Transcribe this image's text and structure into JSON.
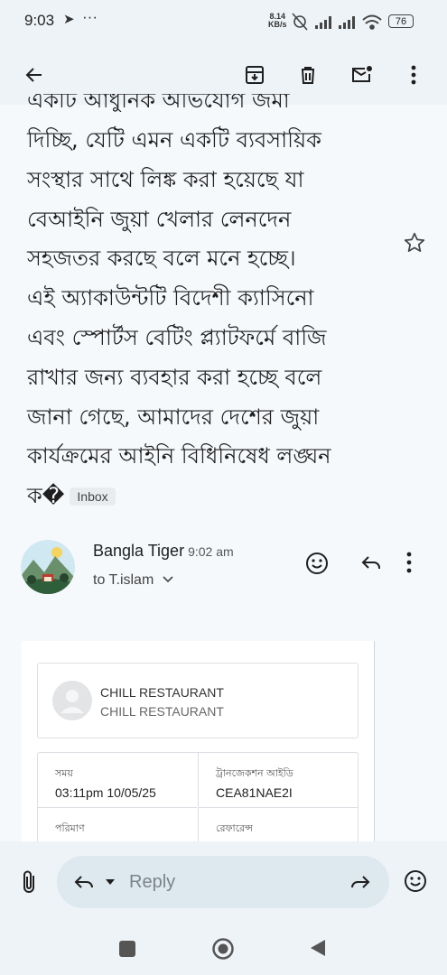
{
  "status_bar": {
    "time": "9:03",
    "arrow": "➤",
    "dots": "···",
    "speed_value": "8.14",
    "speed_unit": "KB/s",
    "battery": "76",
    "icons": [
      "alarm-off-icon",
      "signal-icon",
      "signal-icon",
      "wifi-icon"
    ]
  },
  "toolbar": {
    "icons": [
      "back-arrow-icon",
      "archive-icon",
      "delete-icon",
      "mark-unread-icon",
      "more-vert-icon"
    ]
  },
  "email": {
    "body_lines": [
      "একটি আধুনিক অভিযোগ জমা",
      "দিচ্ছি, যেটি এমন একটি ব্যবসায়িক",
      "সংস্থার সাথে লিঙ্ক করা হয়েছে যা",
      "বেআইনি জুয়া খেলার লেনদেন",
      "সহজতর করছে বলে মনে হচ্ছে।",
      "এই অ্যাকাউন্টটি বিদেশী ক্যাসিনো",
      "এবং স্পোর্টস বেটিং প্ল্যাটফর্মে বাজি",
      "রাখার জন্য ব্যবহার করা হচ্ছে বলে",
      "জানা গেছে, আমাদের দেশের জুয়া",
      "কার্যক্রমের আইনি বিধিনিষেধ লঙ্ঘন"
    ],
    "last_line": "ক�",
    "label": "Inbox",
    "sender": "Bangla Tiger",
    "time": "9:02 am",
    "to": "to T.islam"
  },
  "receipt": {
    "merchant_name": "CHILL RESTAURANT",
    "merchant_sub": "CHILL RESTAURANT",
    "fields": [
      {
        "label": "সময়",
        "value": "03:11pm 10/05/25"
      },
      {
        "label": "ট্রানজেকশন আইডি",
        "value": "CEA81NAE2I"
      },
      {
        "label": "পরিমাণ",
        "value": ""
      },
      {
        "label": "রেফারেন্স",
        "value": ""
      }
    ]
  },
  "compose": {
    "reply_placeholder": "Reply"
  },
  "colors": {
    "background": "#f6f9fc",
    "chrome": "#eef3f7",
    "reply_pill": "#dde8ef",
    "accent_icon": "#1f1f1f"
  }
}
